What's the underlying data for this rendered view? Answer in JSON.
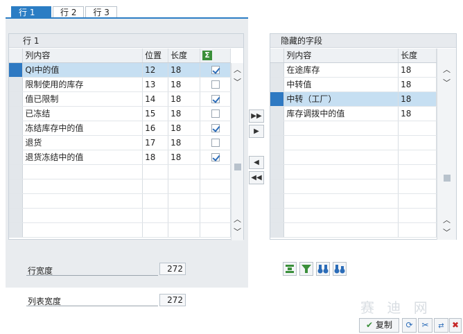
{
  "tabs": [
    {
      "label": "行 1"
    },
    {
      "label": "行 2"
    },
    {
      "label": "行 3"
    }
  ],
  "left": {
    "title": "行 1",
    "headers": {
      "content": "列内容",
      "position": "位置",
      "length": "长度"
    },
    "rows": [
      {
        "content": "QI中的值",
        "position": "12",
        "length": "18",
        "checked": true
      },
      {
        "content": "限制使用的库存",
        "position": "13",
        "length": "18",
        "checked": false
      },
      {
        "content": "值已限制",
        "position": "14",
        "length": "18",
        "checked": true
      },
      {
        "content": "已冻结",
        "position": "15",
        "length": "18",
        "checked": false
      },
      {
        "content": "冻结库存中的值",
        "position": "16",
        "length": "18",
        "checked": true
      },
      {
        "content": "退货",
        "position": "17",
        "length": "18",
        "checked": false
      },
      {
        "content": "退货冻结中的值",
        "position": "18",
        "length": "18",
        "checked": true
      }
    ],
    "selected_index": 0,
    "sum_icon": "sum-icon",
    "row_width_label": "行宽度",
    "row_width_value": "272"
  },
  "list_width_label": "列表宽度",
  "list_width_value": "272",
  "right": {
    "title": "隐藏的字段",
    "headers": {
      "content": "列内容",
      "length": "长度"
    },
    "rows": [
      {
        "content": "在途库存",
        "length": "18"
      },
      {
        "content": "中转值",
        "length": "18"
      },
      {
        "content": "中转（工厂）",
        "length": "18"
      },
      {
        "content": "库存调拨中的值",
        "length": "18"
      }
    ],
    "selected_index": 2
  },
  "mid_buttons": [
    "move-all-right-icon",
    "move-right-icon",
    "move-left-icon",
    "move-all-left-icon"
  ],
  "tool_buttons": [
    "align-center-icon",
    "filter-icon",
    "binoculars-icon",
    "find-next-icon"
  ],
  "footer": {
    "copy_label": "复制",
    "buttons": [
      "refresh-icon",
      "cut-icon",
      "transfer-icon",
      "cancel-icon"
    ]
  },
  "watermark": "赛 迪 网",
  "colors": {
    "accent": "#2b7dc4",
    "selected_row": "#c6dff2",
    "selected_marker": "#2e79c2",
    "cancel": "#c62828",
    "ok": "#3a8f3a"
  }
}
